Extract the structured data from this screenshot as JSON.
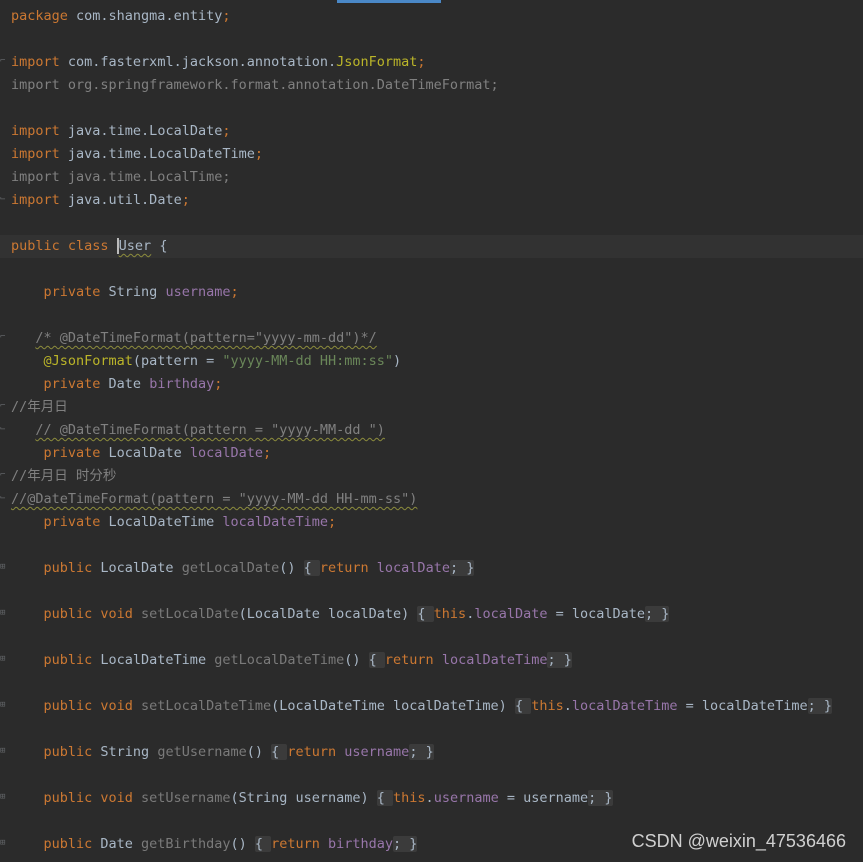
{
  "colors": {
    "background": "#2b2b2b",
    "current_line": "#323232",
    "keyword": "#cc7832",
    "string": "#6a8759",
    "annotation": "#bbb529",
    "field": "#9876aa",
    "comment": "#808080",
    "plain": "#a9b7c6",
    "tab_indicator": "#4a88c7"
  },
  "editor": {
    "lines": [
      {
        "fold": "",
        "tokens": [
          {
            "t": "package",
            "c": "kw"
          },
          {
            "t": " com.shangma.entity",
            "c": "ident"
          },
          {
            "t": ";",
            "c": "kw"
          }
        ]
      },
      {
        "fold": "",
        "tokens": []
      },
      {
        "fold": "open",
        "tokens": [
          {
            "t": "import",
            "c": "kw"
          },
          {
            "t": " com.fasterxml.jackson.annotation.",
            "c": "ident"
          },
          {
            "t": "JsonFormat",
            "c": "ann"
          },
          {
            "t": ";",
            "c": "kw"
          }
        ]
      },
      {
        "fold": "",
        "tokens": [
          {
            "t": "import org.springframework.format.annotation.DateTimeFormat;",
            "c": "unused"
          }
        ]
      },
      {
        "fold": "",
        "tokens": []
      },
      {
        "fold": "",
        "tokens": [
          {
            "t": "import",
            "c": "kw"
          },
          {
            "t": " java.time.LocalDate",
            "c": "ident"
          },
          {
            "t": ";",
            "c": "kw"
          }
        ]
      },
      {
        "fold": "",
        "tokens": [
          {
            "t": "import",
            "c": "kw"
          },
          {
            "t": " java.time.LocalDateTime",
            "c": "ident"
          },
          {
            "t": ";",
            "c": "kw"
          }
        ]
      },
      {
        "fold": "",
        "tokens": [
          {
            "t": "import java.time.LocalTime;",
            "c": "unused"
          }
        ]
      },
      {
        "fold": "close",
        "tokens": [
          {
            "t": "import",
            "c": "kw"
          },
          {
            "t": " java.util.Date",
            "c": "ident"
          },
          {
            "t": ";",
            "c": "kw"
          }
        ]
      },
      {
        "fold": "",
        "tokens": []
      },
      {
        "fold": "",
        "current": true,
        "tokens": [
          {
            "t": "public class ",
            "c": "kw"
          },
          {
            "t": "User",
            "c": "ident-wavy-caret"
          },
          {
            "t": " {",
            "c": "ident"
          }
        ]
      },
      {
        "fold": "",
        "tokens": []
      },
      {
        "fold": "",
        "tokens": [
          {
            "t": "    private ",
            "c": "kw"
          },
          {
            "t": "String ",
            "c": "ident"
          },
          {
            "t": "username",
            "c": "field"
          },
          {
            "t": ";",
            "c": "kw"
          }
        ]
      },
      {
        "fold": "",
        "tokens": []
      },
      {
        "fold": "open",
        "tokens": [
          {
            "t": "   ",
            "c": "ident"
          },
          {
            "t": "/* @DateTimeFormat(pattern=\"yyyy-mm-dd\")*/",
            "c": "com-wavy"
          }
        ]
      },
      {
        "fold": "",
        "tokens": [
          {
            "t": "    ",
            "c": "ident"
          },
          {
            "t": "@JsonFormat",
            "c": "ann"
          },
          {
            "t": "(pattern = ",
            "c": "ident"
          },
          {
            "t": "\"yyyy-MM-dd HH:mm:ss\"",
            "c": "str"
          },
          {
            "t": ")",
            "c": "ident"
          }
        ]
      },
      {
        "fold": "",
        "tokens": [
          {
            "t": "    private ",
            "c": "kw"
          },
          {
            "t": "Date ",
            "c": "ident"
          },
          {
            "t": "birthday",
            "c": "field"
          },
          {
            "t": ";",
            "c": "kw"
          }
        ]
      },
      {
        "fold": "open",
        "tokens": [
          {
            "t": "//年月日",
            "c": "com"
          }
        ]
      },
      {
        "fold": "close",
        "tokens": [
          {
            "t": "   ",
            "c": "ident"
          },
          {
            "t": "// @DateTimeFormat(pattern = \"yyyy-MM-dd \")",
            "c": "com-wavy"
          }
        ]
      },
      {
        "fold": "",
        "tokens": [
          {
            "t": "    private ",
            "c": "kw"
          },
          {
            "t": "LocalDate ",
            "c": "ident"
          },
          {
            "t": "localDate",
            "c": "field"
          },
          {
            "t": ";",
            "c": "kw"
          }
        ]
      },
      {
        "fold": "open",
        "tokens": [
          {
            "t": "//年月日 时分秒",
            "c": "com"
          }
        ]
      },
      {
        "fold": "close",
        "tokens": [
          {
            "t": "//@DateTimeFormat(pattern = \"yyyy-MM-dd HH-mm-ss\")",
            "c": "com-wavy"
          }
        ]
      },
      {
        "fold": "",
        "tokens": [
          {
            "t": "    private ",
            "c": "kw"
          },
          {
            "t": "LocalDateTime ",
            "c": "ident"
          },
          {
            "t": "localDateTime",
            "c": "field"
          },
          {
            "t": ";",
            "c": "kw"
          }
        ]
      },
      {
        "fold": "",
        "tokens": []
      },
      {
        "fold": "plus",
        "tokens": [
          {
            "t": "    public ",
            "c": "kw"
          },
          {
            "t": "LocalDate ",
            "c": "ident"
          },
          {
            "t": "getLocalDate",
            "c": "muted"
          },
          {
            "t": "() ",
            "c": "ident"
          },
          {
            "t": "{ ",
            "c": "fold"
          },
          {
            "t": "return ",
            "c": "kw"
          },
          {
            "t": "localDate",
            "c": "field"
          },
          {
            "t": "; }",
            "c": "fold"
          }
        ]
      },
      {
        "fold": "",
        "tokens": []
      },
      {
        "fold": "plus",
        "tokens": [
          {
            "t": "    public void ",
            "c": "kw"
          },
          {
            "t": "setLocalDate",
            "c": "muted"
          },
          {
            "t": "(LocalDate localDate) ",
            "c": "ident"
          },
          {
            "t": "{ ",
            "c": "fold"
          },
          {
            "t": "this",
            "c": "kw"
          },
          {
            "t": ".",
            "c": "ident"
          },
          {
            "t": "localDate",
            "c": "field"
          },
          {
            "t": " = localDate",
            "c": "ident"
          },
          {
            "t": "; }",
            "c": "fold"
          }
        ]
      },
      {
        "fold": "",
        "tokens": []
      },
      {
        "fold": "plus",
        "tokens": [
          {
            "t": "    public ",
            "c": "kw"
          },
          {
            "t": "LocalDateTime ",
            "c": "ident"
          },
          {
            "t": "getLocalDateTime",
            "c": "muted"
          },
          {
            "t": "() ",
            "c": "ident"
          },
          {
            "t": "{ ",
            "c": "fold"
          },
          {
            "t": "return ",
            "c": "kw"
          },
          {
            "t": "localDateTime",
            "c": "field"
          },
          {
            "t": "; }",
            "c": "fold"
          }
        ]
      },
      {
        "fold": "",
        "tokens": []
      },
      {
        "fold": "plus",
        "tokens": [
          {
            "t": "    public void ",
            "c": "kw"
          },
          {
            "t": "setLocalDateTime",
            "c": "muted"
          },
          {
            "t": "(LocalDateTime localDateTime) ",
            "c": "ident"
          },
          {
            "t": "{ ",
            "c": "fold"
          },
          {
            "t": "this",
            "c": "kw"
          },
          {
            "t": ".",
            "c": "ident"
          },
          {
            "t": "localDateTime",
            "c": "field"
          },
          {
            "t": " = localDateTime",
            "c": "ident"
          },
          {
            "t": "; }",
            "c": "fold"
          }
        ]
      },
      {
        "fold": "",
        "tokens": []
      },
      {
        "fold": "plus",
        "tokens": [
          {
            "t": "    public ",
            "c": "kw"
          },
          {
            "t": "String ",
            "c": "ident"
          },
          {
            "t": "getUsername",
            "c": "muted"
          },
          {
            "t": "() ",
            "c": "ident"
          },
          {
            "t": "{ ",
            "c": "fold"
          },
          {
            "t": "return ",
            "c": "kw"
          },
          {
            "t": "username",
            "c": "field"
          },
          {
            "t": "; }",
            "c": "fold"
          }
        ]
      },
      {
        "fold": "",
        "tokens": []
      },
      {
        "fold": "plus",
        "tokens": [
          {
            "t": "    public void ",
            "c": "kw"
          },
          {
            "t": "setUsername",
            "c": "muted"
          },
          {
            "t": "(String username) ",
            "c": "ident"
          },
          {
            "t": "{ ",
            "c": "fold"
          },
          {
            "t": "this",
            "c": "kw"
          },
          {
            "t": ".",
            "c": "ident"
          },
          {
            "t": "username",
            "c": "field"
          },
          {
            "t": " = username",
            "c": "ident"
          },
          {
            "t": "; }",
            "c": "fold"
          }
        ]
      },
      {
        "fold": "",
        "tokens": []
      },
      {
        "fold": "plus",
        "tokens": [
          {
            "t": "    public ",
            "c": "kw"
          },
          {
            "t": "Date ",
            "c": "ident"
          },
          {
            "t": "getBirthday",
            "c": "muted"
          },
          {
            "t": "() ",
            "c": "ident"
          },
          {
            "t": "{ ",
            "c": "fold"
          },
          {
            "t": "return ",
            "c": "kw"
          },
          {
            "t": "birthday",
            "c": "field"
          },
          {
            "t": "; }",
            "c": "fold"
          }
        ]
      }
    ]
  },
  "watermark": "CSDN @weixin_47536466"
}
